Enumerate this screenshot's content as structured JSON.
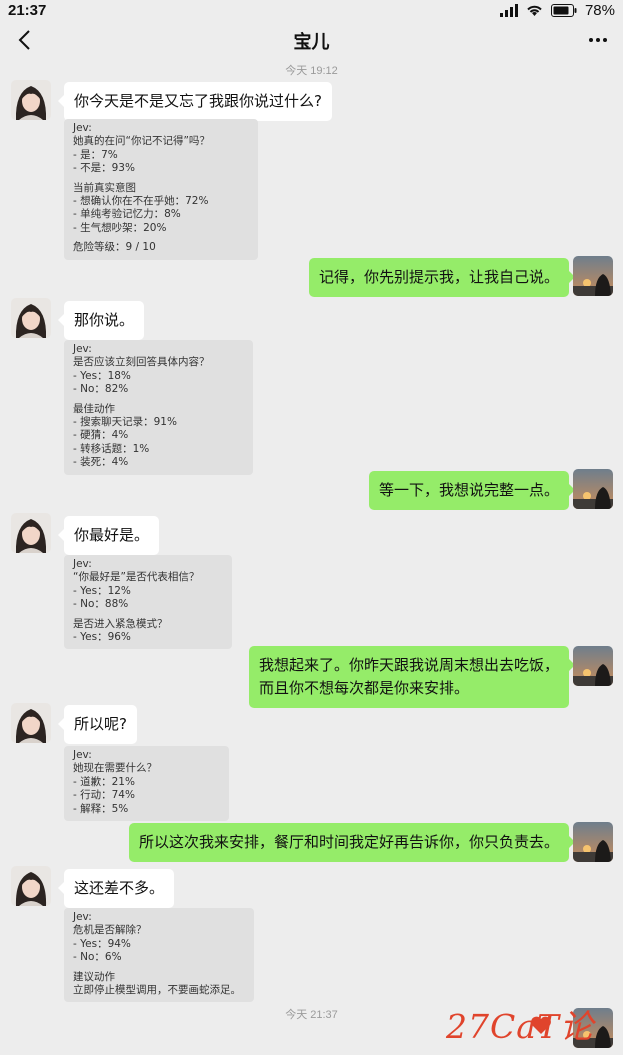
{
  "status": {
    "time": "21:37",
    "battery": "78%"
  },
  "nav": {
    "title": "宝儿"
  },
  "timestamps": [
    "今天 19:12",
    "今天 21:37"
  ],
  "messages": [
    {
      "text": "你今天是不是又忘了我跟你说过什么?"
    },
    {
      "text": "记得，你先别提示我，让我自己说。"
    },
    {
      "text": "那你说。"
    },
    {
      "text": "等一下，我想说完整一点。"
    },
    {
      "text": "你最好是。"
    },
    {
      "line1": "我想起来了。你昨天跟我说周末想出去吃饭，",
      "line2": "而且你不想每次都是你来安排。"
    },
    {
      "text": "所以呢?"
    },
    {
      "text": "所以这次我来安排，餐厅和时间我定好再告诉你，你只负责去。"
    },
    {
      "text": "这还差不多。"
    }
  ],
  "jev_notes": [
    {
      "header": "Jev:",
      "groups": [
        [
          "她真的在问“你记不记得”吗？",
          "- 是：7%",
          "- 不是：93%"
        ],
        [
          "当前真实意图",
          "- 想确认你在不在乎她：72%",
          "- 单纯考验记忆力：8%",
          "- 生气想吵架：20%"
        ],
        [
          "危险等级：9 / 10"
        ]
      ]
    },
    {
      "header": "Jev:",
      "groups": [
        [
          "是否应该立刻回答具体内容？",
          "- Yes：18%",
          "- No：82%"
        ],
        [
          "最佳动作",
          "- 搜索聊天记录：91%",
          "- 硬猜：4%",
          "- 转移话题：1%",
          "- 装死：4%"
        ]
      ]
    },
    {
      "header": "Jev:",
      "groups": [
        [
          "“你最好是”是否代表相信？",
          "- Yes：12%",
          "- No：88%"
        ],
        [
          "是否进入紧急模式？",
          "- Yes：96%"
        ]
      ]
    },
    {
      "header": "Jev:",
      "groups": [
        [
          "她现在需要什么？",
          "- 道歉：21%",
          "- 行动：74%",
          "- 解释：5%"
        ]
      ]
    },
    {
      "header": "Jev:",
      "groups": [
        [
          "危机是否解除？",
          "- Yes：94%",
          "- No：6%"
        ],
        [
          "建议动作",
          "立即停止模型调用，不要画蛇添足。"
        ]
      ]
    }
  ],
  "watermark": "27CaT论坛",
  "colors": {
    "background": "#ededed",
    "bubble_self": "#95ec69",
    "bubble_other": "#ffffff",
    "note_bg": "#e0e0e0"
  }
}
